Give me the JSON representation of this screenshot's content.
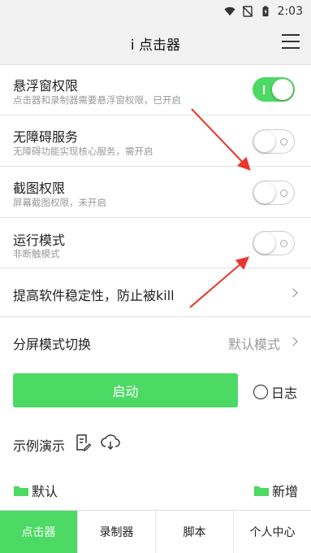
{
  "status_bar": {
    "time": "2:03",
    "icons": [
      "wifi-icon",
      "no-sim-icon",
      "battery-icon"
    ]
  },
  "header": {
    "title": "i 点击器",
    "menu_icon": "hamburger-menu-icon"
  },
  "settings": [
    {
      "title": "悬浮窗权限",
      "subtitle": "点击器和录制器需要悬浮窗权限，已开启",
      "toggle": "on"
    },
    {
      "title": "无障碍服务",
      "subtitle": "无障碍功能实现核心服务，需开启",
      "toggle": "off"
    },
    {
      "title": "截图权限",
      "subtitle": "屏幕截图权限，未开启",
      "toggle": "off"
    },
    {
      "title": "运行模式",
      "subtitle": "非断触模式",
      "toggle": "off"
    }
  ],
  "stability": {
    "label": "提高软件稳定性，防止被kill"
  },
  "split_mode": {
    "label": "分屏模式切换",
    "value": "默认模式"
  },
  "actions": {
    "start_label": "启动",
    "log_label": "日志"
  },
  "demo": {
    "label": "示例演示",
    "icons": [
      "document-edit-icon",
      "cloud-download-icon"
    ]
  },
  "folders": {
    "default_label": "默认",
    "add_label": "新增"
  },
  "tabs": [
    {
      "label": "点击器",
      "active": true
    },
    {
      "label": "录制器",
      "active": false
    },
    {
      "label": "脚本",
      "active": false
    },
    {
      "label": "个人中心",
      "active": false
    }
  ],
  "colors": {
    "accent": "#4cd964",
    "annotation_arrow": "#e8362c"
  }
}
